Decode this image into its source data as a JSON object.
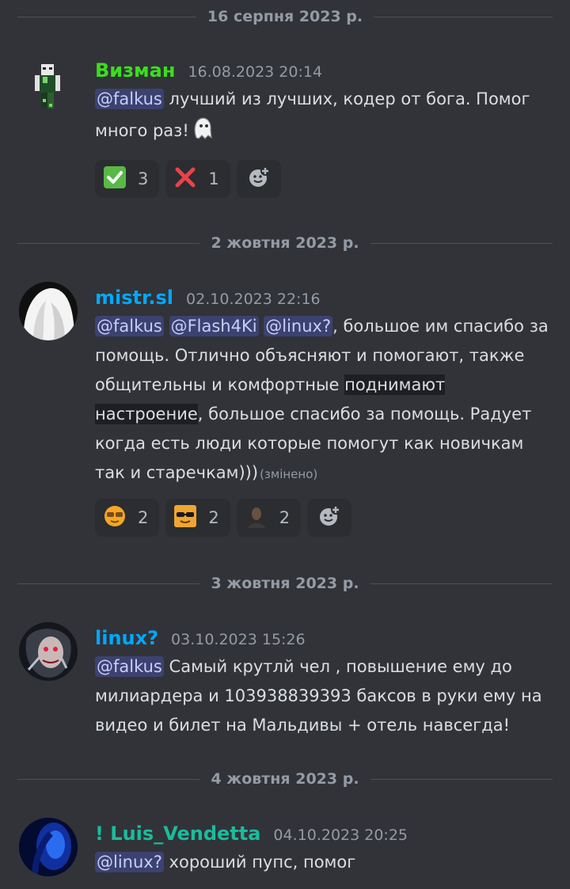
{
  "dividers": [
    "16 серпня 2023 р.",
    "2 жовтня 2023 р.",
    "3 жовтня 2023 р.",
    "4 жовтня 2023 р."
  ],
  "messages": [
    {
      "author": "Визман",
      "author_color": "#3ddc20",
      "timestamp": "16.08.2023 20:14",
      "mention1": "@falkus",
      "text": " лучший из лучших, кодер от бога. Помог много раз!",
      "reactions": [
        {
          "icon": "check-mark-emoji-icon",
          "count": "3"
        },
        {
          "icon": "cross-mark-emoji-icon",
          "count": "1"
        }
      ]
    },
    {
      "author": "mistr.sl",
      "author_color": "#00a8fc",
      "timestamp": "02.10.2023 22:16",
      "mention1": "@falkus",
      "mention2": "@Flash4Ki",
      "mention3": "@linux?",
      "text1": ", большое им спасибо за помощь. Отлично объясняют и помогают, также общительны и комфортные ",
      "highlight": "поднимают настроение",
      "text2": ", большое спасибо за помощь. Радует когда есть люди которые помогут как новичкам так и старечкам)))",
      "edited": "(змінено)",
      "reactions": [
        {
          "icon": "cool-face-emoji-icon",
          "count": "2"
        },
        {
          "icon": "sunglasses-emoji-icon",
          "count": "2"
        },
        {
          "icon": "person-emoji-icon",
          "count": "2"
        }
      ]
    },
    {
      "author": "linux?",
      "author_color": "#00a8fc",
      "timestamp": "03.10.2023 15:26",
      "mention1": "@falkus",
      "text": " Самый крутлй чел , повышение ему до милиардера и 103938839393 баксов в руки ему на видео и билет на Мальдивы + отель навсегда!"
    },
    {
      "author": "! Luis_Vendetta",
      "author_color": "#1abc9c",
      "timestamp": "04.10.2023 20:25",
      "mention1": "@linux?",
      "text": " хороший пупс, помог"
    }
  ]
}
